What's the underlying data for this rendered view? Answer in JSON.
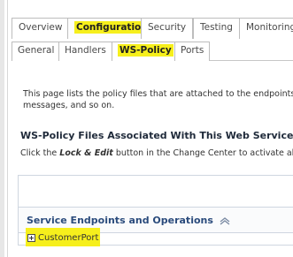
{
  "tabs": {
    "primary": [
      {
        "label": "Overview"
      },
      {
        "label": "Configuration"
      },
      {
        "label": "Security"
      },
      {
        "label": "Testing"
      },
      {
        "label": "Monitoring"
      }
    ],
    "secondary": [
      {
        "label": "General"
      },
      {
        "label": "Handlers"
      },
      {
        "label": "WS-Policy"
      },
      {
        "label": "Ports"
      }
    ]
  },
  "intro": {
    "line1": "This page lists the policy files that are attached to the endpoints a",
    "line2": "messages, and so on."
  },
  "section": {
    "title": "WS-Policy Files Associated With This Web Service",
    "note_prefix": "Click the ",
    "note_emphasis": "Lock & Edit",
    "note_suffix": " button in the Change Center to activate all"
  },
  "table": {
    "title": "Service Endpoints and Operations",
    "rows": [
      {
        "label": "CustomerPort"
      }
    ]
  },
  "colors": {
    "highlight": "#f6ef1c",
    "section_link": "#2a4b7c"
  }
}
